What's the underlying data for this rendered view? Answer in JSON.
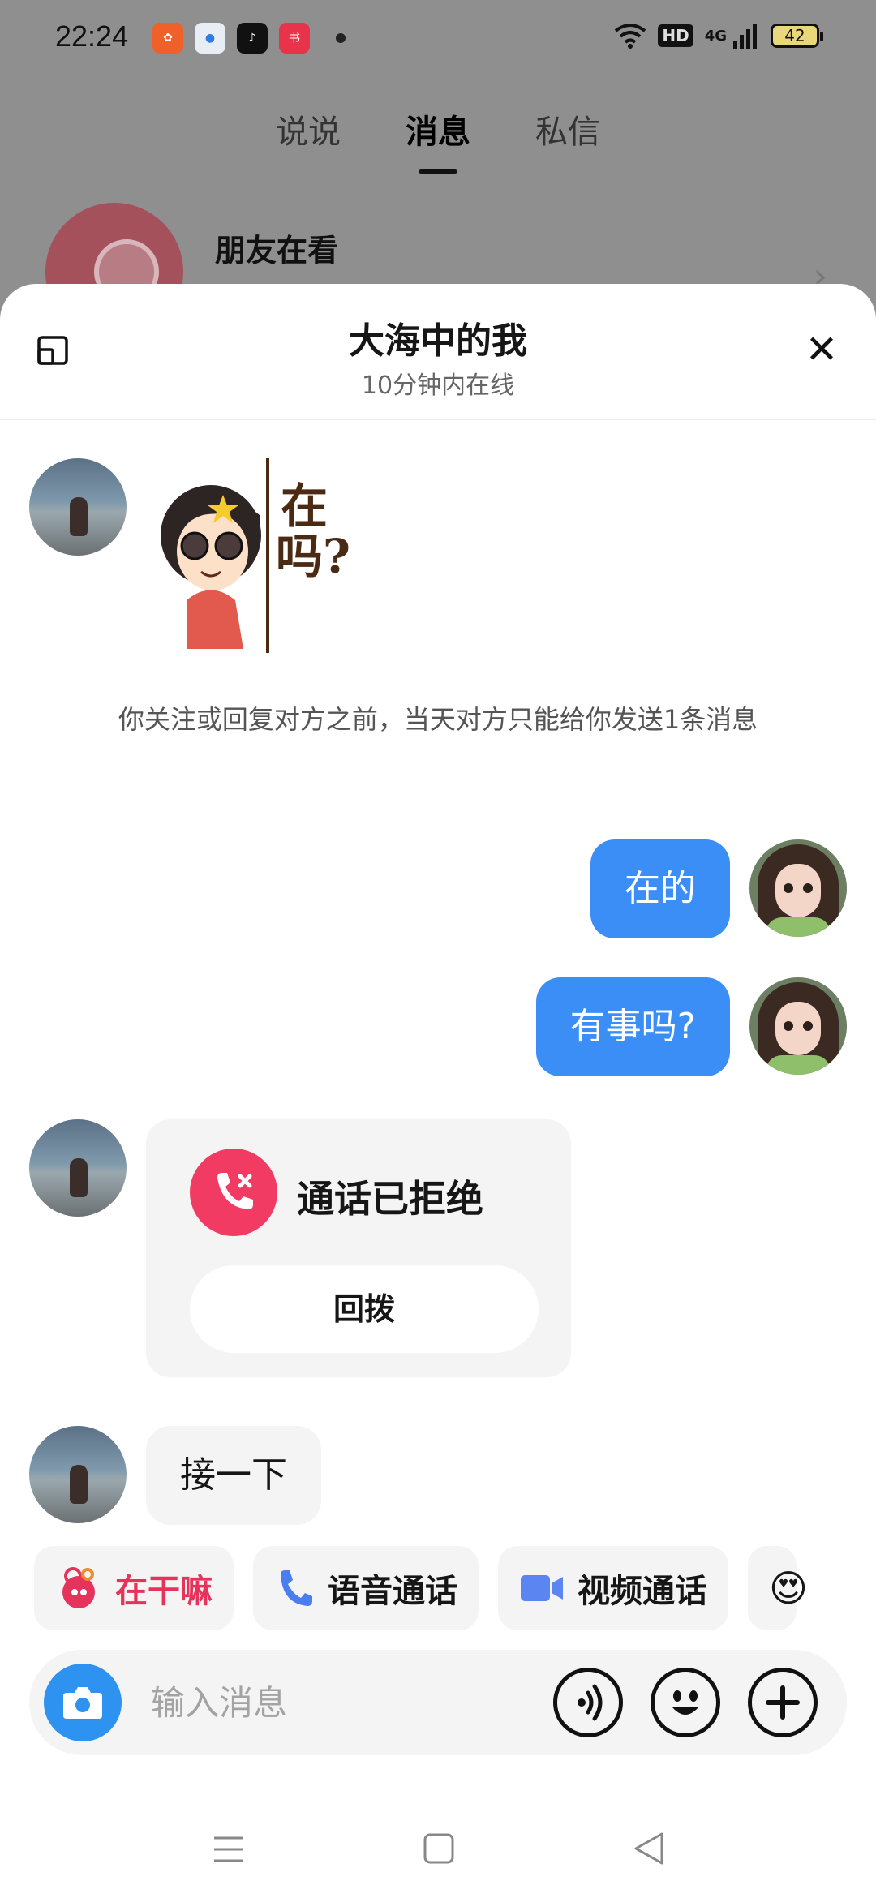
{
  "status_bar": {
    "time": "22:24",
    "network": "4G",
    "hd": "HD",
    "battery": "42"
  },
  "background": {
    "tabs": [
      "说说",
      "消息",
      "私信"
    ],
    "active_tab": 1,
    "friends_label": "朋友在看"
  },
  "chat": {
    "title": "大海中的我",
    "subtitle": "10分钟内在线",
    "sticker_text": "在吗?",
    "notice": "你关注或回复对方之前，当天对方只能给你发送1条消息",
    "my_messages": [
      "在的",
      "有事吗?"
    ],
    "call_card": {
      "title": "通话已拒绝",
      "button": "回拨"
    },
    "her_message": "接一下"
  },
  "quick_actions": [
    {
      "label": "在干嘛",
      "icon": "doing-icon"
    },
    {
      "label": "语音通话",
      "icon": "phone-icon"
    },
    {
      "label": "视频通话",
      "icon": "video-camera-icon"
    }
  ],
  "input": {
    "placeholder": "输入消息",
    "value": ""
  },
  "colors": {
    "accent_blue": "#3a8ef6",
    "decline_red": "#f23b63",
    "doing_pink": "#e5335c"
  }
}
